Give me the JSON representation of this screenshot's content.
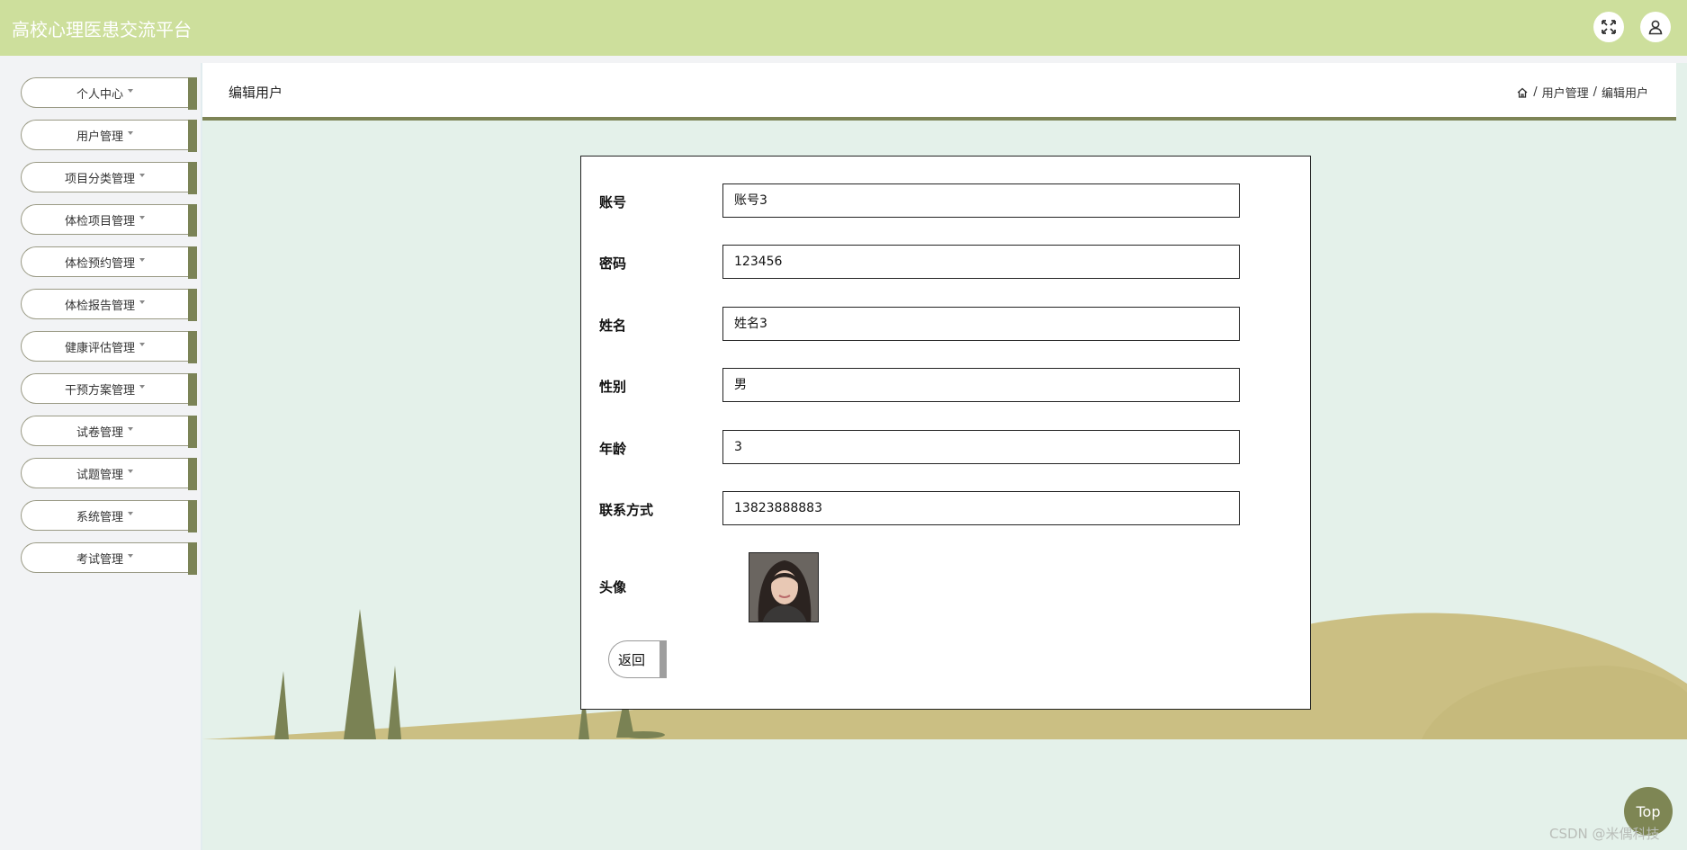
{
  "app": {
    "title": "高校心理医患交流平台"
  },
  "sidebar": {
    "items": [
      {
        "label": "个人中心"
      },
      {
        "label": "用户管理"
      },
      {
        "label": "项目分类管理"
      },
      {
        "label": "体检项目管理"
      },
      {
        "label": "体检预约管理"
      },
      {
        "label": "体检报告管理"
      },
      {
        "label": "健康评估管理"
      },
      {
        "label": "干预方案管理"
      },
      {
        "label": "试卷管理"
      },
      {
        "label": "试题管理"
      },
      {
        "label": "系统管理"
      },
      {
        "label": "考试管理"
      }
    ]
  },
  "header": {
    "page_title": "编辑用户",
    "breadcrumb": [
      "用户管理",
      "编辑用户"
    ],
    "breadcrumb_sep": "/"
  },
  "form": {
    "fields": [
      {
        "label": "账号",
        "value": "账号3"
      },
      {
        "label": "密码",
        "value": "123456"
      },
      {
        "label": "姓名",
        "value": "姓名3"
      },
      {
        "label": "性别",
        "value": "男"
      },
      {
        "label": "年龄",
        "value": "3"
      },
      {
        "label": "联系方式",
        "value": "13823888883"
      }
    ],
    "avatar_label": "头像",
    "back_label": "返回"
  },
  "fab": {
    "label": "Top"
  },
  "watermark": "CSDN @米偶科技",
  "colors": {
    "topbar": "#cddf9c",
    "accent": "#7b8356",
    "content_bg": "#e4f1ea",
    "hill": "#cbbf83"
  }
}
